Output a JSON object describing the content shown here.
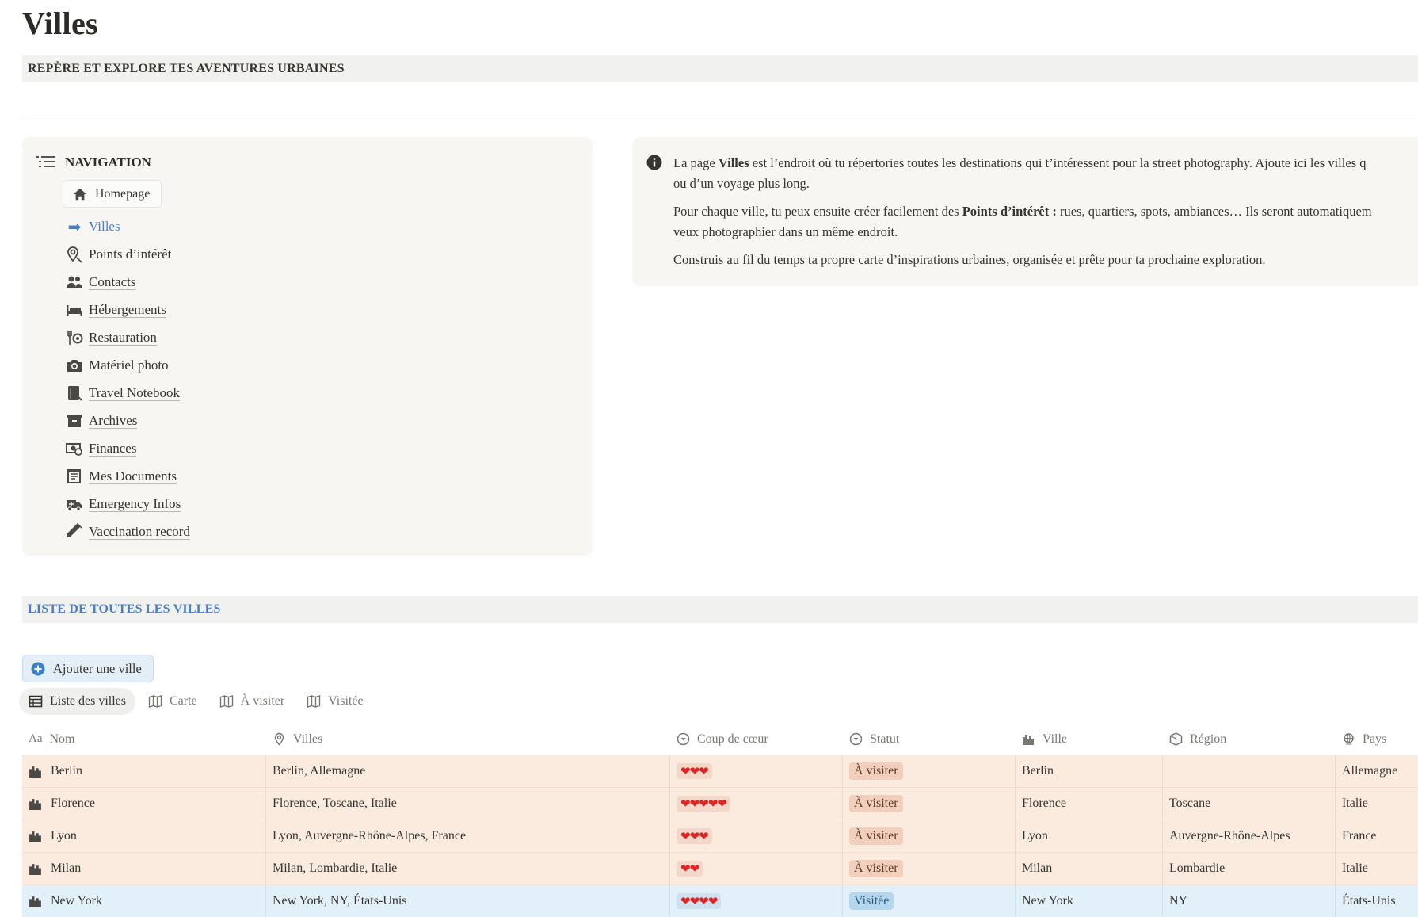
{
  "page": {
    "title": "Villes",
    "subtitle": "REPÈRE ET EXPLORE TES AVENTURES URBAINES"
  },
  "navigation": {
    "header": "NAVIGATION",
    "home": "Homepage",
    "current": "Villes",
    "items": [
      {
        "label": "Points d’intérêt",
        "icon": "map-pin-icon"
      },
      {
        "label": "Contacts",
        "icon": "people-icon"
      },
      {
        "label": "Hébergements",
        "icon": "bed-icon"
      },
      {
        "label": "Restauration",
        "icon": "utensils-icon"
      },
      {
        "label": "Matériel photo",
        "icon": "camera-icon"
      },
      {
        "label": "Travel Notebook",
        "icon": "notebook-icon"
      },
      {
        "label": "Archives",
        "icon": "archive-icon"
      },
      {
        "label": "Finances",
        "icon": "money-icon"
      },
      {
        "label": "Mes Documents",
        "icon": "documents-icon"
      },
      {
        "label": "Emergency Infos",
        "icon": "ambulance-icon"
      },
      {
        "label": "Vaccination record",
        "icon": "syringe-icon"
      }
    ]
  },
  "callout": {
    "p1_a": "La page ",
    "p1_b": "Villes",
    "p1_c": " est l’endroit où tu répertories toutes les destinations qui t’intéressent pour la street photography. Ajoute ici les villes q",
    "p1_line2": "ou d’un voyage plus long.",
    "p2_a": "Pour chaque ville, tu peux ensuite créer facilement des ",
    "p2_b": "Points d’intérêt :",
    "p2_c": " rues, quartiers, spots, ambiances… Ils seront automatiquem",
    "p2_line2": "veux photographier dans un même endroit.",
    "p3": "Construis au fil du temps ta propre carte d’inspirations urbaines, organisée et prête pour ta prochaine exploration."
  },
  "list": {
    "banner": "LISTE DE TOUTES LES VILLES",
    "add_button": "Ajouter une ville",
    "tabs": [
      "Liste des villes",
      "Carte",
      "À visiter",
      "Visitée"
    ],
    "columns": [
      "Nom",
      "Villes",
      "Coup de cœur",
      "Statut",
      "Ville",
      "Région",
      "Pays"
    ],
    "rows": [
      {
        "nom": "Berlin",
        "villes": "Berlin, Allemagne",
        "coeur": "❤❤❤",
        "statut": "À visiter",
        "ville": "Berlin",
        "region": "",
        "pays": "Allemagne",
        "tone": "orange"
      },
      {
        "nom": "Florence",
        "villes": "Florence, Toscane, Italie",
        "coeur": "❤❤❤❤❤",
        "statut": "À visiter",
        "ville": "Florence",
        "region": "Toscane",
        "pays": "Italie",
        "tone": "orange"
      },
      {
        "nom": "Lyon",
        "villes": "Lyon, Auvergne-Rhône-Alpes, France",
        "coeur": "❤❤❤",
        "statut": "À visiter",
        "ville": "Lyon",
        "region": "Auvergne-Rhône-Alpes",
        "pays": "France",
        "tone": "orange"
      },
      {
        "nom": "Milan",
        "villes": "Milan, Lombardie, Italie",
        "coeur": "❤❤",
        "statut": "À visiter",
        "ville": "Milan",
        "region": "Lombardie",
        "pays": "Italie",
        "tone": "orange"
      },
      {
        "nom": "New York",
        "villes": "New York, NY, États-Unis",
        "coeur": "❤❤❤❤",
        "statut": "Visitée",
        "ville": "New York",
        "region": "NY",
        "pays": "États-Unis",
        "tone": "blue"
      }
    ]
  },
  "colors": {
    "accent": "#4a7fbf",
    "orange_row": "#fbebdf",
    "blue_row": "#e2f0fa",
    "heart": "#e02424"
  }
}
